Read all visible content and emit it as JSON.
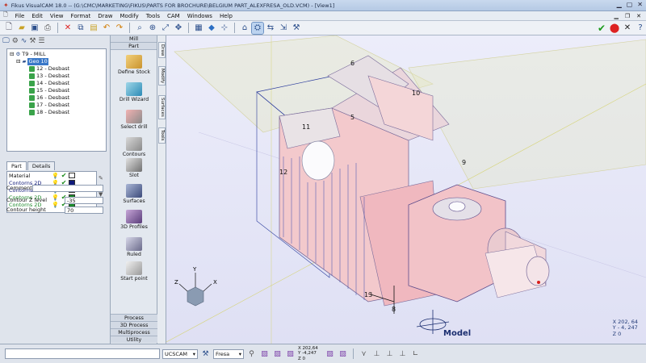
{
  "window": {
    "title": "Fikus VisualCAM 18.0 -- (G:\\CMC\\MARKETING\\FIKUS\\PARTS FOR BROCHURE\\BELGIUM PART_ALEXFRESA_OLD.VCM) - [View1]"
  },
  "menu": [
    "File",
    "Edit",
    "View",
    "Format",
    "Draw",
    "Modify",
    "Tools",
    "CAM",
    "Windows",
    "Help"
  ],
  "tree": {
    "root": "T9 - MILL",
    "geo": "Geo 10",
    "ops": [
      "12 - Desbast",
      "13 - Desbast",
      "14 - Desbast",
      "15 - Desbast",
      "16 - Desbast",
      "17 - Desbast",
      "18 - Desbast"
    ]
  },
  "tabs": [
    "Part",
    "Details"
  ],
  "contours": [
    {
      "name": "Material",
      "color": "#ffffff"
    },
    {
      "name": "Contorns 2D",
      "color": "#101a7a"
    },
    {
      "name": "Contorns 2D",
      "color": "#101a7a"
    },
    {
      "name": "Contorns 2D",
      "color": "#1c8a2a"
    },
    {
      "name": "Contorns 2D",
      "color": "#1c8a2a"
    }
  ],
  "fields": {
    "comment_label": "Comment",
    "comment_value": "",
    "z_label": "Contour Z level",
    "z_value": "-35",
    "h_label": "Contour height",
    "h_value": "70"
  },
  "mill_panel": {
    "header1": "Mill",
    "header2": "Part",
    "items": [
      "Define Stock",
      "Drill Wizard",
      "Select drill",
      "Contours",
      "Slot",
      "Surfaces",
      "3D Profiles",
      "Ruled",
      "Start point"
    ],
    "footer": [
      "Process",
      "3D Process",
      "Multiprocess",
      "Utility"
    ]
  },
  "vtabs": [
    "Draw",
    "Modify",
    "Surfaces",
    "Tools"
  ],
  "viewport": {
    "labels": [
      "6",
      "10",
      "11",
      "5",
      "9",
      "12",
      "13",
      "8"
    ],
    "model_label": "Model",
    "coords": [
      "X 202, 64",
      "Y - 4, 247",
      "Z 0"
    ]
  },
  "status": {
    "ucs": "UCSCAM",
    "tool": "Fresa",
    "coords": [
      "X 202,64",
      "Y -4,247",
      "Z 0"
    ]
  },
  "colors": {
    "accent": "#3a78c8",
    "part": "#f2c3c3",
    "wire": "#2a3b9c"
  }
}
